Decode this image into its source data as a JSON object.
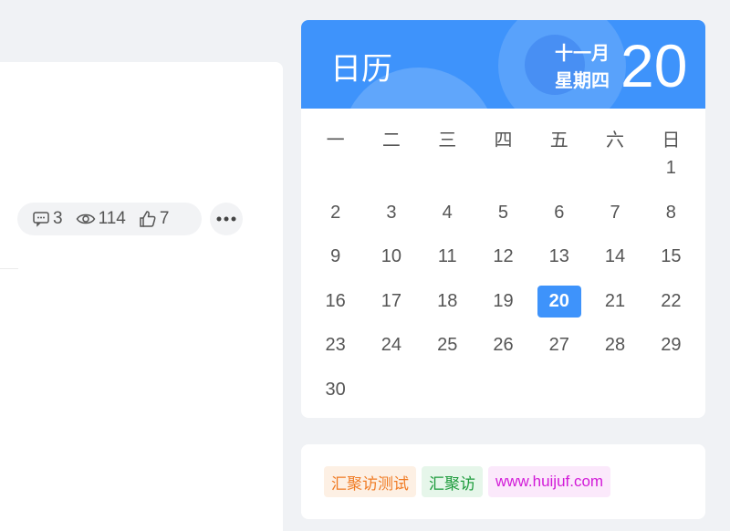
{
  "post": {
    "stats": {
      "comments": "3",
      "views": "114",
      "likes": "7"
    },
    "icons": {
      "comment": "comment-icon",
      "views": "eye-icon",
      "likes": "thumbs-up-icon",
      "more": "more-dots-icon"
    }
  },
  "calendar": {
    "title": "日历",
    "month": "十一月",
    "weekday": "星期四",
    "day": "20",
    "week_headers": [
      "一",
      "二",
      "三",
      "四",
      "五",
      "六",
      "日"
    ],
    "weeks": [
      [
        "",
        "",
        "",
        "",
        "",
        "",
        "1"
      ],
      [
        "2",
        "3",
        "4",
        "5",
        "6",
        "7",
        "8"
      ],
      [
        "9",
        "10",
        "11",
        "12",
        "13",
        "14",
        "15"
      ],
      [
        "16",
        "17",
        "18",
        "19",
        "20",
        "21",
        "22"
      ],
      [
        "23",
        "24",
        "25",
        "26",
        "27",
        "28",
        "29"
      ],
      [
        "30",
        "",
        "",
        "",
        "",
        "",
        ""
      ]
    ],
    "today": "20",
    "accent_color": "#3e93fb"
  },
  "tags": [
    {
      "label": "汇聚访测试",
      "color": "#f07b24"
    },
    {
      "label": "汇聚访",
      "color": "#1a9a39"
    },
    {
      "label": "www.huijuf.com",
      "color": "#d21bd8"
    }
  ]
}
